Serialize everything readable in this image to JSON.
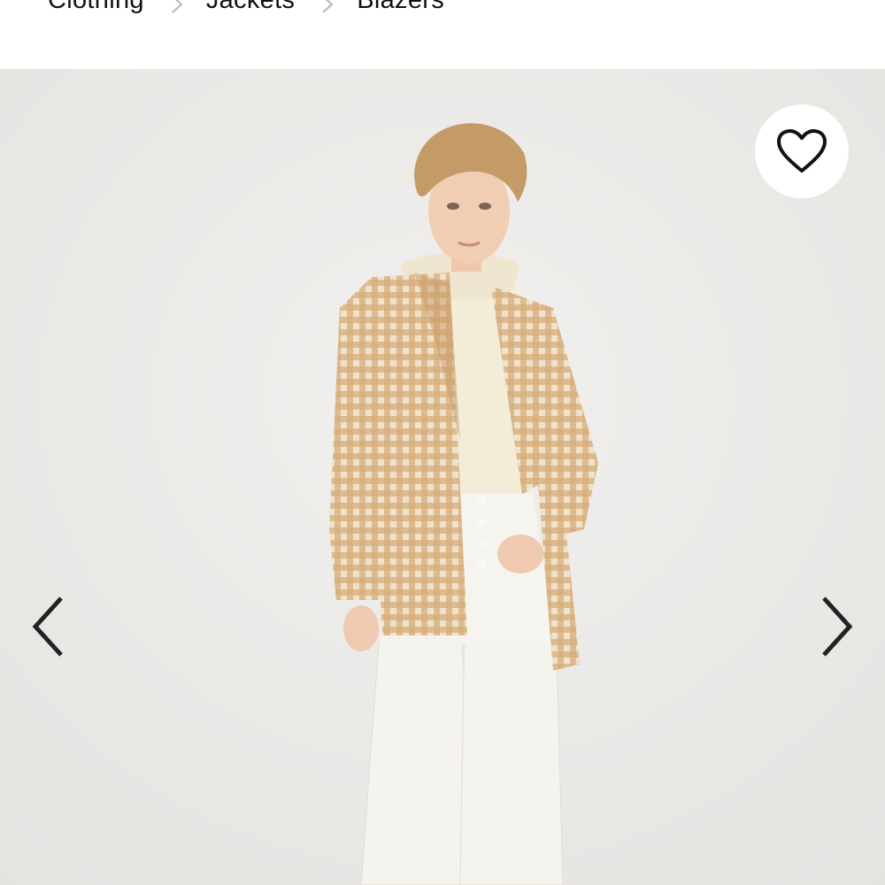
{
  "breadcrumb": {
    "items": [
      {
        "label": "Clothing"
      },
      {
        "label": "Jackets"
      },
      {
        "label": "Blazers"
      }
    ]
  },
  "gallery": {
    "product": "Blazers",
    "favorite_icon": "heart-outline-icon",
    "prev_icon": "chevron-left-icon",
    "next_icon": "chevron-right-icon"
  },
  "colors": {
    "background": "#ececeb",
    "text": "#111111",
    "separator": "#b5b5b5",
    "blazer": "#d4a878",
    "hoodie": "#f3ecd9",
    "jeans": "#f4f2ec"
  }
}
